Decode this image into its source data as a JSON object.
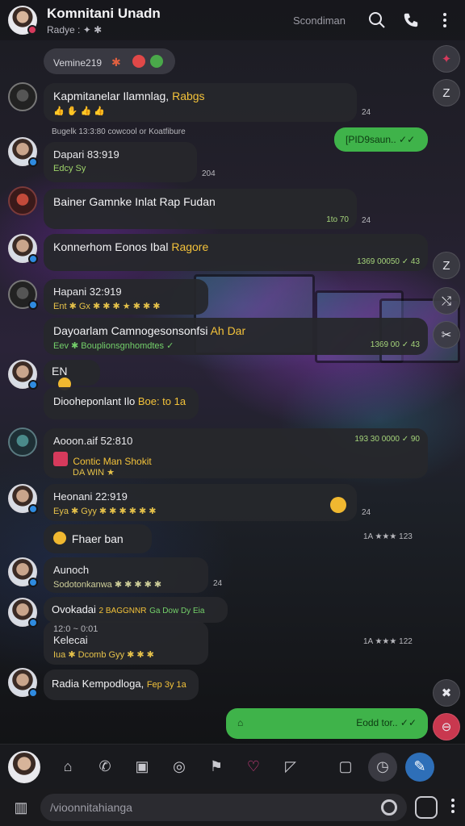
{
  "header": {
    "title": "Komnitani Unadn",
    "subtitle": "Radye : ✦ ✱",
    "search_label": "Scondiman"
  },
  "pill": {
    "text": "Vemine219",
    "marker": "✱"
  },
  "messages": [
    {
      "name": "Kapmitanelar Ilamnlag,",
      "highlight": "Rabgs",
      "line2": "👍 ✋ 👍 👍",
      "time": "24"
    },
    {
      "meta": "Bugelk 13:3:80 cowcool or Koatfibure"
    },
    {
      "outgoing": "[PID9saun.. ✓✓"
    },
    {
      "name": "Dapari 83:919",
      "line2": "Edcy Sy",
      "time": "204"
    },
    {
      "name": "Bainer Gamnke Inlat Rap Fudan",
      "time": "1to 70",
      "side": "24"
    },
    {
      "name": "Konnerhom Eonos Ibal",
      "highlight": "Ragore",
      "time": "1369 00050 ✓ 43"
    },
    {
      "name": "Hapani 32:919",
      "line2": "Ent ✱ Gx ✱ ✱ ✱ ★ ✱ ✱ ✱"
    },
    {
      "name": "Dayoarlam Camnogesonsonfsi",
      "highlight": "Ah Dar",
      "sub": "Eev ✱ Bouplionsgnhomdtes ✓",
      "time": "1369 00 ✓ 43"
    },
    {
      "name": "EN"
    },
    {
      "name": "Diooheponlant Ilo",
      "highlight": "Boe: to 1a"
    },
    {
      "name": "Aooon.aif 52:810",
      "line2": "Contic Man Shokit",
      "sub": "DA WIN ★",
      "time": "193 30 0000 ✓ 90"
    },
    {
      "name": "Heonani 22:919",
      "line2": "Eya ✱ Gyy ✱ ✱ ✱ ✱ ✱ ✱",
      "side": "24"
    },
    {
      "name": "Fhaer ban",
      "meta": "1A ★★★ 123"
    },
    {
      "name": "Aunoch",
      "line2": "Sodotonkanwa ✱ ✱ ✱ ✱ ✱",
      "side": "24"
    },
    {
      "name": "Ovokadai",
      "highlight": "2 BAGGNNR",
      "extra": "Ga Dow Dy Eia"
    },
    {
      "name": "Kelecai",
      "meta_top": "12:0 ~ 0:01",
      "line2": "Iua ✱ Dcomb Gyy ✱ ✱ ✱",
      "meta": "1A ★★★ 122"
    },
    {
      "name": "Radia Kempodloga,",
      "highlight": "Fep 3y 1a"
    },
    {
      "outgoing": "Eodd tor.. ✓✓"
    }
  ],
  "tabbar": {
    "items": [
      "home-icon",
      "phone-icon",
      "book-icon",
      "chat-icon",
      "flag-icon",
      "heart-icon",
      "note-icon",
      "sticker-icon",
      "timer-icon",
      "pen-icon"
    ]
  },
  "input": {
    "placeholder": "/vioonnitahianga"
  },
  "colors": {
    "bubble": "#26272c",
    "outgoing": "#3fb34a",
    "accent_red": "#d63a5c",
    "accent_blue": "#2f8be0"
  }
}
